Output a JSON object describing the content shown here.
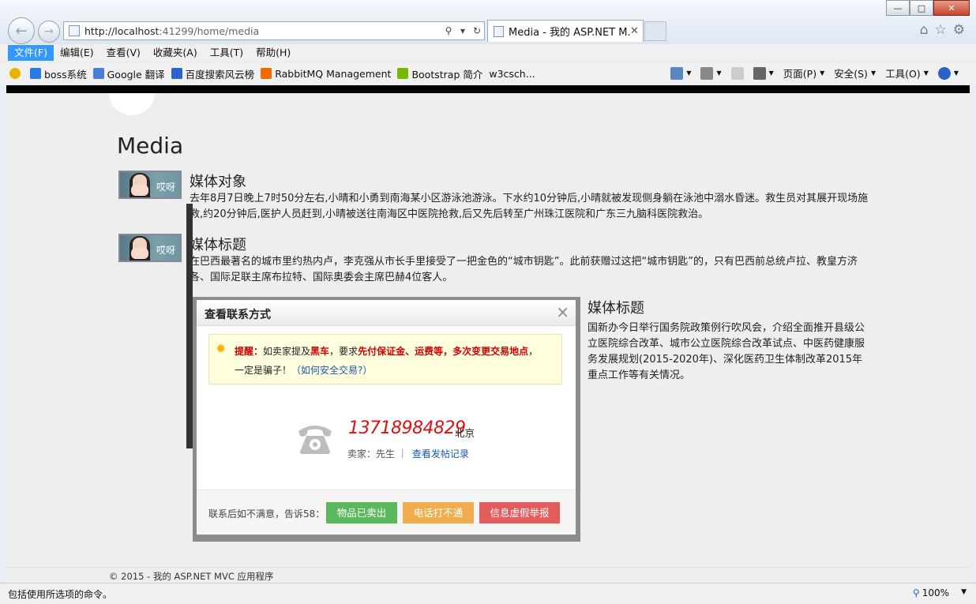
{
  "browser": {
    "url_host": "http://localhost",
    "url_rest": ":41299/home/media",
    "tab_title": "Media - 我的 ASP.NET M...",
    "tab_close": "✕",
    "win_min": "—",
    "win_max": "□",
    "win_close": "✕",
    "right_icons": [
      "home-icon",
      "star-icon",
      "gear-icon"
    ]
  },
  "menu": [
    "文件(F)",
    "编辑(E)",
    "查看(V)",
    "收藏夹(A)",
    "工具(T)",
    "帮助(H)"
  ],
  "favorites": [
    {
      "label": "boss系统",
      "color": "#2c7be5"
    },
    {
      "label": "Google 翻译",
      "color": "#4a7fd4"
    },
    {
      "label": "百度搜索风云榜",
      "color": "#2d62c8"
    },
    {
      "label": "RabbitMQ Management",
      "color": "#f06a00"
    },
    {
      "label": "Bootstrap 简介",
      "color": "#76b900"
    },
    {
      "label": "w3csch...",
      "color": ""
    }
  ],
  "commands": {
    "page": "页面(P)",
    "safety": "安全(S)",
    "tools": "工具(O)"
  },
  "page": {
    "title": "Media",
    "items": [
      {
        "title": "媒体对象",
        "thumb_caption": "哎呀",
        "body": "去年8月7日晚上7时50分左右,小晴和小勇到南海某小区游泳池游泳。下水约10分钟后,小晴就被发现侧身躺在泳池中溺水昏迷。救生员对其展开现场施救,约20分钟后,医护人员赶到,小晴被送往南海区中医院抢救,后又先后转至广州珠江医院和广东三九脑科医院救治。"
      },
      {
        "title": "媒体标题",
        "thumb_caption": "哎呀",
        "body": "在巴西最著名的城市里约热内卢，李克强从市长手里接受了一把金色的“城市钥匙”。此前获赠过这把“城市钥匙”的，只有巴西前总统卢拉、教皇方济各、国际足联主席布拉特、国际奥委会主席巴赫4位客人。"
      },
      {
        "title": "媒体标题",
        "body": "国新办今日举行国务院政策例行吹风会，介绍全面推开县级公立医院综合改革、城市公立医院综合改革试点、中医药健康服务发展规划(2015-2020年)、深化医药卫生体制改革2015年重点工作等有关情况。"
      }
    ],
    "footer": "© 2015 - 我的 ASP.NET MVC 应用程序"
  },
  "modal": {
    "title": "查看联系方式",
    "close": "×",
    "tip_label": "提醒：",
    "tip_a": "如卖家提及",
    "tip_b": "黑车",
    "tip_c": "，要求",
    "tip_d": "先付保证金、运费等，多次变更交易地点",
    "tip_e": "，",
    "tip_f": "一定是骗子！",
    "tip_link": "（如何安全交易?）",
    "phone": "13718984829",
    "city": "北京",
    "seller": "卖家：先生 ｜",
    "history_link": "查看发帖记录",
    "footer_label": "联系后如不满意，告诉58：",
    "btn_sold": "物品已卖出",
    "btn_unreachable": "电话打不通",
    "btn_report": "信息虚假举报"
  },
  "status": {
    "text": "包括使用所选项的命令。",
    "zoom": "100%"
  }
}
